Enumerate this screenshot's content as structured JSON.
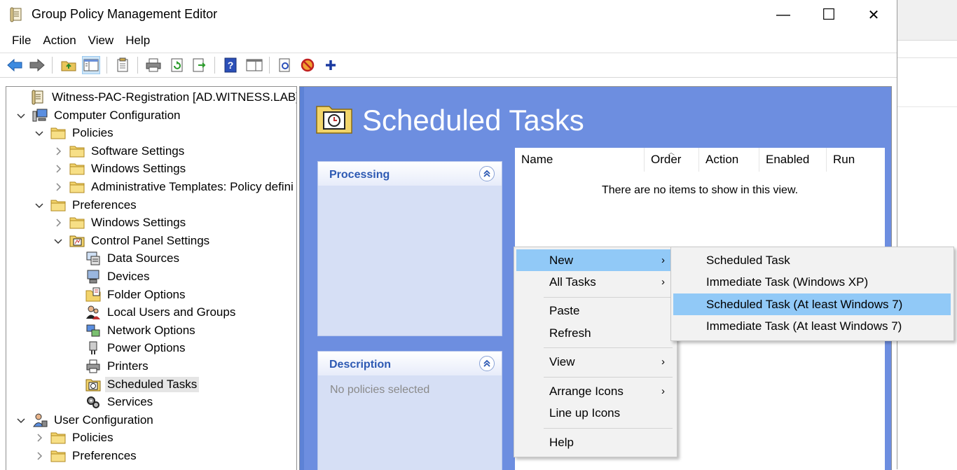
{
  "window": {
    "title": "Group Policy Management Editor",
    "minimize": "—",
    "maximize": "☐",
    "close": "✕"
  },
  "menubar": [
    "File",
    "Action",
    "View",
    "Help"
  ],
  "tree": {
    "items": [
      {
        "label": "Witness-PAC-Registration [AD.WITNESS.LAB] Poli",
        "icon": "policy-doc-icon",
        "level": 0,
        "twisty": "none"
      },
      {
        "label": "Computer Configuration",
        "icon": "computer-icon",
        "level": 0,
        "twisty": "expanded"
      },
      {
        "label": "Policies",
        "icon": "folder-icon",
        "level": 1,
        "twisty": "expanded"
      },
      {
        "label": "Software Settings",
        "icon": "folder-icon",
        "level": 2,
        "twisty": "collapsed"
      },
      {
        "label": "Windows Settings",
        "icon": "folder-icon",
        "level": 2,
        "twisty": "collapsed"
      },
      {
        "label": "Administrative Templates: Policy defini",
        "icon": "folder-icon",
        "level": 2,
        "twisty": "collapsed"
      },
      {
        "label": "Preferences",
        "icon": "folder-icon",
        "level": 1,
        "twisty": "expanded"
      },
      {
        "label": "Windows Settings",
        "icon": "folder-icon",
        "level": 2,
        "twisty": "collapsed"
      },
      {
        "label": "Control Panel Settings",
        "icon": "control-panel-icon",
        "level": 2,
        "twisty": "expanded"
      },
      {
        "label": "Data Sources",
        "icon": "data-sources-icon",
        "level": 3,
        "twisty": "none"
      },
      {
        "label": "Devices",
        "icon": "devices-icon",
        "level": 3,
        "twisty": "none"
      },
      {
        "label": "Folder Options",
        "icon": "folder-options-icon",
        "level": 3,
        "twisty": "none"
      },
      {
        "label": "Local Users and Groups",
        "icon": "users-icon",
        "level": 3,
        "twisty": "none"
      },
      {
        "label": "Network Options",
        "icon": "network-icon",
        "level": 3,
        "twisty": "none"
      },
      {
        "label": "Power Options",
        "icon": "power-icon",
        "level": 3,
        "twisty": "none"
      },
      {
        "label": "Printers",
        "icon": "printer-icon",
        "level": 3,
        "twisty": "none"
      },
      {
        "label": "Scheduled Tasks",
        "icon": "scheduled-tasks-icon",
        "level": 3,
        "twisty": "none",
        "selected": true
      },
      {
        "label": "Services",
        "icon": "services-icon",
        "level": 3,
        "twisty": "none"
      },
      {
        "label": "User Configuration",
        "icon": "user-config-icon",
        "level": 0,
        "twisty": "expanded"
      },
      {
        "label": "Policies",
        "icon": "folder-icon",
        "level": 1,
        "twisty": "collapsed"
      },
      {
        "label": "Preferences",
        "icon": "folder-icon",
        "level": 1,
        "twisty": "collapsed"
      }
    ]
  },
  "details": {
    "title": "Scheduled Tasks",
    "processing_title": "Processing",
    "description_title": "Description",
    "description_text": "No policies selected",
    "columns": [
      "Name",
      "Order",
      "Action",
      "Enabled",
      "Run"
    ],
    "empty_text": "There are no items to show in this view."
  },
  "context_menu": {
    "items": [
      "New",
      "All Tasks",
      "Paste",
      "Refresh",
      "View",
      "Arrange Icons",
      "Line up Icons",
      "Help"
    ],
    "arrow": "›"
  },
  "submenu": {
    "items": [
      "Scheduled Task",
      "Immediate Task (Windows XP)",
      "Scheduled Task (At least Windows 7)",
      "Immediate Task (At least Windows 7)"
    ]
  },
  "colors": {
    "details_bg": "#6d8ee0",
    "menu_highlight": "#91c9f7",
    "panel_title": "#2d59b3"
  }
}
